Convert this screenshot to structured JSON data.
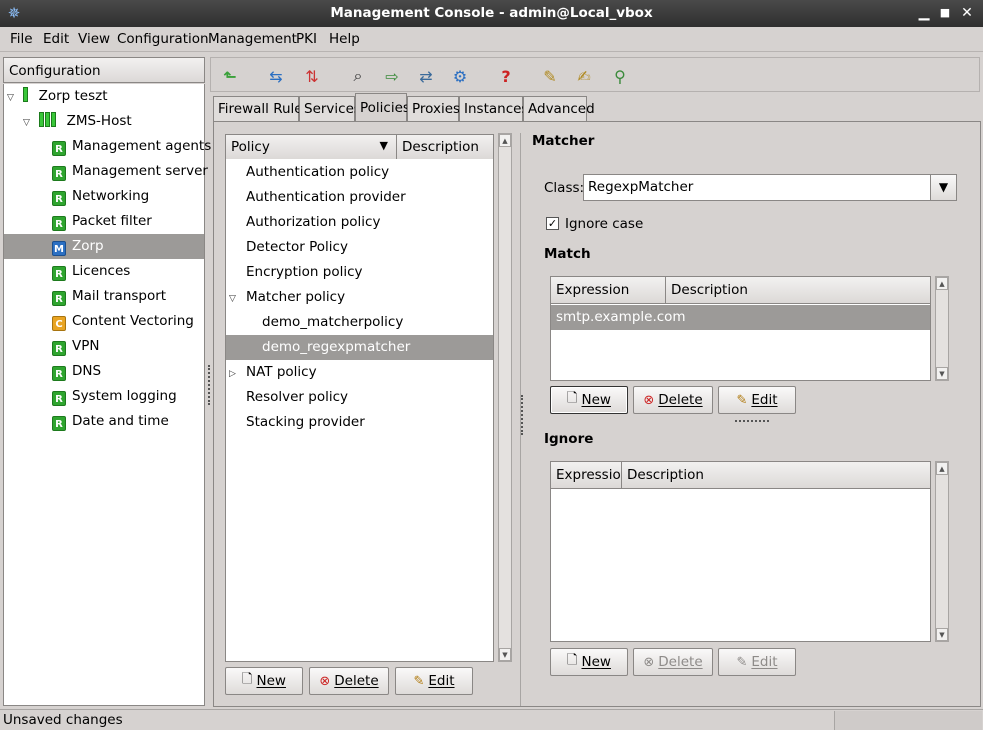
{
  "window": {
    "title": "Management Console - admin@Local_vbox"
  },
  "menu": [
    "File",
    "Edit",
    "View",
    "Configuration",
    "Management",
    "PKI",
    "Help"
  ],
  "config_tree": {
    "header": "Configuration",
    "root": "Zorp teszt",
    "host": "ZMS-Host",
    "items": [
      {
        "label": "Management agents",
        "badge": "R"
      },
      {
        "label": "Management server",
        "badge": "R"
      },
      {
        "label": "Networking",
        "badge": "R"
      },
      {
        "label": "Packet filter",
        "badge": "R"
      },
      {
        "label": "Zorp",
        "badge": "M"
      },
      {
        "label": "Licences",
        "badge": "R"
      },
      {
        "label": "Mail transport",
        "badge": "R"
      },
      {
        "label": "Content Vectoring",
        "badge": "C"
      },
      {
        "label": "VPN",
        "badge": "R"
      },
      {
        "label": "DNS",
        "badge": "R"
      },
      {
        "label": "System logging",
        "badge": "R"
      },
      {
        "label": "Date and time",
        "badge": "R"
      }
    ]
  },
  "tabs": [
    "Firewall Rules",
    "Services",
    "Policies",
    "Proxies",
    "Instances",
    "Advanced"
  ],
  "policy_list": {
    "columns": [
      "Policy",
      "Description"
    ],
    "items": [
      "Authentication policy",
      "Authentication provider",
      "Authorization policy",
      "Detector Policy",
      "Encryption policy",
      "Matcher policy",
      "demo_matcherpolicy",
      "demo_regexpmatcher",
      "NAT policy",
      "Resolver policy",
      "Stacking provider"
    ],
    "buttons": {
      "new": "New",
      "delete": "Delete",
      "edit": "Edit"
    }
  },
  "matcher": {
    "title": "Matcher",
    "class_label": "Class:",
    "class_value": "RegexpMatcher",
    "ignore_case_label": "Ignore case",
    "match_title": "Match",
    "match_columns": [
      "Expression",
      "Description"
    ],
    "match_rows": [
      "smtp.example.com"
    ],
    "ignore_title": "Ignore",
    "ignore_columns": [
      "Expression",
      "Description"
    ],
    "buttons": {
      "new": "New",
      "delete": "Delete",
      "edit": "Edit"
    }
  },
  "status": {
    "text": "Unsaved changes"
  }
}
